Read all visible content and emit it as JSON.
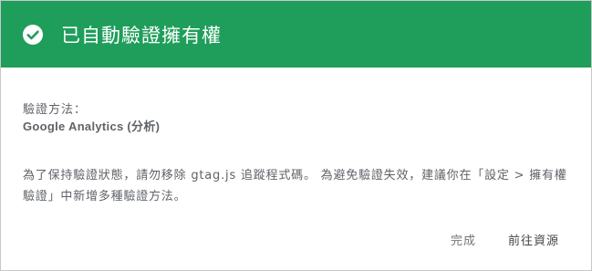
{
  "header": {
    "icon": "check-circle-icon",
    "title": "已自動驗證擁有權",
    "background_color": "#1e9e5a"
  },
  "body": {
    "method_label": "驗證方法：",
    "method_value": "Google Analytics (分析)",
    "description": "為了保持驗證狀態，請勿移除 gtag.js 追蹤程式碼。 為避免驗證失效，建議你在「設定 > 擁有權驗證」中新增多種驗證方法。"
  },
  "actions": {
    "done_label": "完成",
    "go_to_property_label": "前往資源"
  }
}
